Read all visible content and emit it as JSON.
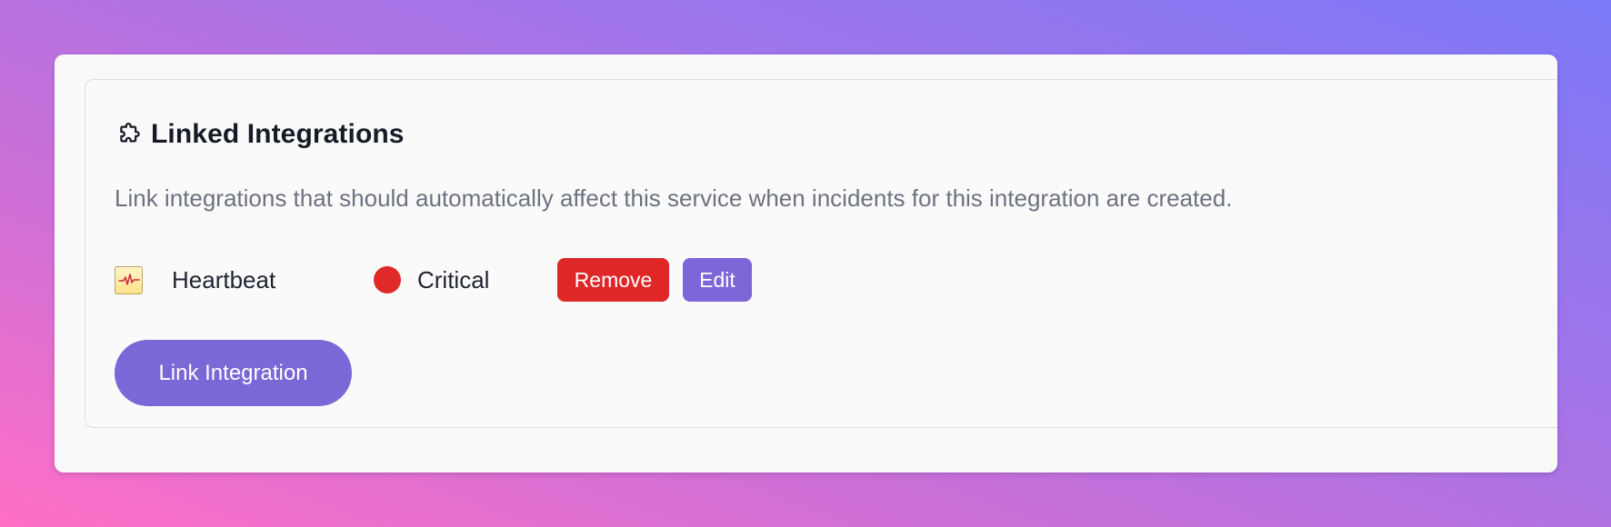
{
  "panel": {
    "title": "Linked Integrations",
    "title_icon": "puzzle-icon",
    "description": "Link integrations that should automatically affect this service when incidents for this integration are created."
  },
  "integrations": [
    {
      "name": "Heartbeat",
      "icon": "heartbeat-icon",
      "severity": "Critical",
      "severity_color": "#e02a2a",
      "remove_label": "Remove",
      "edit_label": "Edit"
    }
  ],
  "actions": {
    "link_label": "Link Integration"
  },
  "colors": {
    "accent": "#7b67d6",
    "danger": "#df2727"
  }
}
